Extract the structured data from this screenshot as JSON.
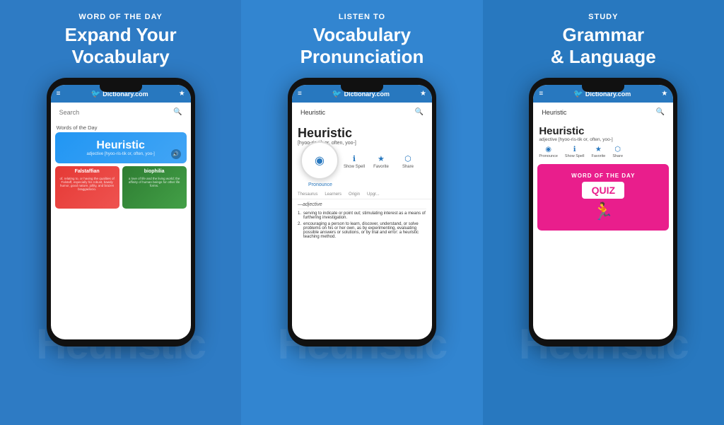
{
  "panels": [
    {
      "id": "panel-1",
      "label": "WORD OF THE DAY",
      "title": "Expand Your\nVocabulary",
      "bg_word": "Heuristic",
      "phone": {
        "search_placeholder": "Search",
        "wotd_label": "Words of the Day",
        "main_word": "Heuristic",
        "main_phonetic": "adjective [hyoo-ris-tik or, often, yoo-]",
        "cards": [
          {
            "word": "Falstaffian",
            "def": "of, relating to, or having the qualities of Falstaff, especially his robust, bawdy humor, good nature, jollity, and brazen braggadocio.",
            "color": "red"
          },
          {
            "word": "biophilia",
            "def": "a love of life and the living world; the affinity of human beings for other life forms.",
            "color": "green"
          }
        ]
      }
    },
    {
      "id": "panel-2",
      "label": "LISTEN TO",
      "title": "Vocabulary\nPronunciation",
      "bg_word": "Heuristic",
      "phone": {
        "search_value": "Heuristic",
        "word": "Heuristic",
        "phonetic": "[hyoo-ris-tik or, often, yoo-]",
        "actions": [
          "Pronounce",
          "Show Spell",
          "Favorite",
          "Share"
        ],
        "action_icons": [
          "◉",
          "ℹ",
          "★",
          "◁"
        ],
        "tabs": [
          "Thesaurus",
          "Learners",
          "Origin",
          "Upgr..."
        ],
        "pos": "—adjective",
        "definitions": [
          "serving to indicate or point out; stimulating interest as a means of furthering investigation.",
          "encouraging a person to learn, discover, understand, or solve problems on his or her own, as by experimenting, evaluating possible answers or solutions, or by trial and error: a heuristic teaching method."
        ]
      }
    },
    {
      "id": "panel-3",
      "label": "STUDY",
      "title": "Grammar\n& Language",
      "bg_word": "Heuristic",
      "phone": {
        "search_value": "Heuristic",
        "word": "Heuristic",
        "phonetic": "adjective [hyoo-ris-tik or, often, yoo-]",
        "actions": [
          "Pronounce",
          "Show Spell",
          "Favorite",
          "Share"
        ],
        "action_icons": [
          "◉",
          "ℹ",
          "★",
          "◁"
        ],
        "quiz_label": "WORD OF THE DAY",
        "quiz_text": "QUIZ"
      }
    }
  ],
  "logo_text": "Dictionary.com",
  "icons": {
    "hamburger": "≡",
    "star": "★",
    "search": "🔍",
    "speaker": "🔊",
    "pronounce_wave": "◉)",
    "share": "◁",
    "favorite": "★",
    "info": "ℹ"
  }
}
